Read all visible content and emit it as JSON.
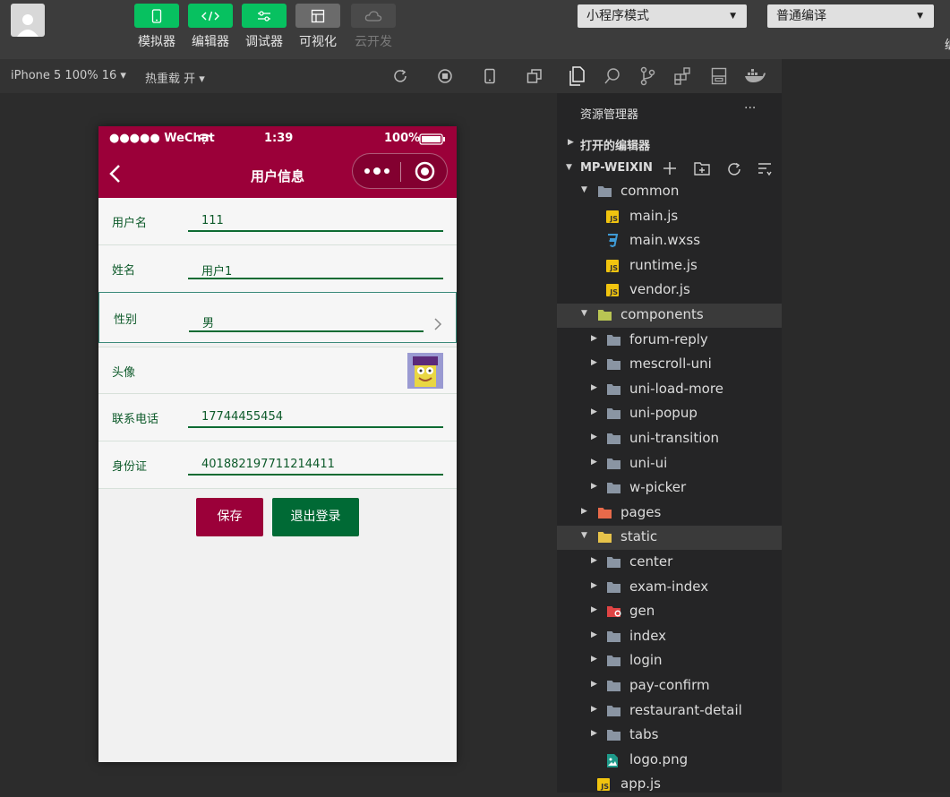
{
  "toolbar": {
    "tools": [
      {
        "label": "模拟器",
        "icon": "phone-icon"
      },
      {
        "label": "编辑器",
        "icon": "code-icon"
      },
      {
        "label": "调试器",
        "icon": "sliders-icon"
      },
      {
        "label": "可视化",
        "icon": "layout-icon"
      },
      {
        "label": "云开发",
        "icon": "cloud-icon"
      }
    ],
    "mode_select": "小程序模式",
    "compile_select": "普通编译",
    "edge_char": "编"
  },
  "subbar": {
    "device": "iPhone 5 100% 16 ▾",
    "hot_reload": "热重载 开 ▾"
  },
  "phone": {
    "status_carrier": "●●●●● WeChat",
    "status_time": "1:39",
    "status_battery": "100%",
    "nav_title": "用户信息",
    "fields": [
      {
        "label": "用户名",
        "value": "111"
      },
      {
        "label": "姓名",
        "value": "用户1"
      },
      {
        "label": "性别",
        "value": "男"
      },
      {
        "label": "头像",
        "value": ""
      },
      {
        "label": "联系电话",
        "value": "17744455454"
      },
      {
        "label": "身份证",
        "value": "401882197711214411"
      }
    ],
    "save_label": "保存",
    "logout_label": "退出登录",
    "colors": {
      "header": "#9b0039",
      "save": "#9b0039",
      "logout": "#006a35"
    }
  },
  "explorer": {
    "title": "资源管理器",
    "more": "···",
    "open_editors": "打开的编辑器",
    "project": "MP-WEIXIN",
    "tree": [
      {
        "name": "common",
        "type": "folder-open",
        "level": 1
      },
      {
        "name": "main.js",
        "type": "js",
        "level": 2
      },
      {
        "name": "main.wxss",
        "type": "css",
        "level": 2
      },
      {
        "name": "runtime.js",
        "type": "js",
        "level": 2
      },
      {
        "name": "vendor.js",
        "type": "js",
        "level": 2
      },
      {
        "name": "components",
        "type": "folder-open-special",
        "level": 1
      },
      {
        "name": "forum-reply",
        "type": "folder",
        "level": 2
      },
      {
        "name": "mescroll-uni",
        "type": "folder",
        "level": 2
      },
      {
        "name": "uni-load-more",
        "type": "folder",
        "level": 2
      },
      {
        "name": "uni-popup",
        "type": "folder",
        "level": 2
      },
      {
        "name": "uni-transition",
        "type": "folder",
        "level": 2
      },
      {
        "name": "uni-ui",
        "type": "folder",
        "level": 2
      },
      {
        "name": "w-picker",
        "type": "folder",
        "level": 2
      },
      {
        "name": "pages",
        "type": "folder-pages",
        "level": 1
      },
      {
        "name": "static",
        "type": "folder-open-yellow",
        "level": 1
      },
      {
        "name": "center",
        "type": "folder",
        "level": 2
      },
      {
        "name": "exam-index",
        "type": "folder",
        "level": 2
      },
      {
        "name": "gen",
        "type": "folder-red",
        "level": 2
      },
      {
        "name": "index",
        "type": "folder",
        "level": 2
      },
      {
        "name": "login",
        "type": "folder",
        "level": 2
      },
      {
        "name": "pay-confirm",
        "type": "folder",
        "level": 2
      },
      {
        "name": "restaurant-detail",
        "type": "folder",
        "level": 2
      },
      {
        "name": "tabs",
        "type": "folder",
        "level": 2
      },
      {
        "name": "logo.png",
        "type": "image",
        "level": 2
      },
      {
        "name": "app.js",
        "type": "js",
        "level": 1
      }
    ]
  }
}
